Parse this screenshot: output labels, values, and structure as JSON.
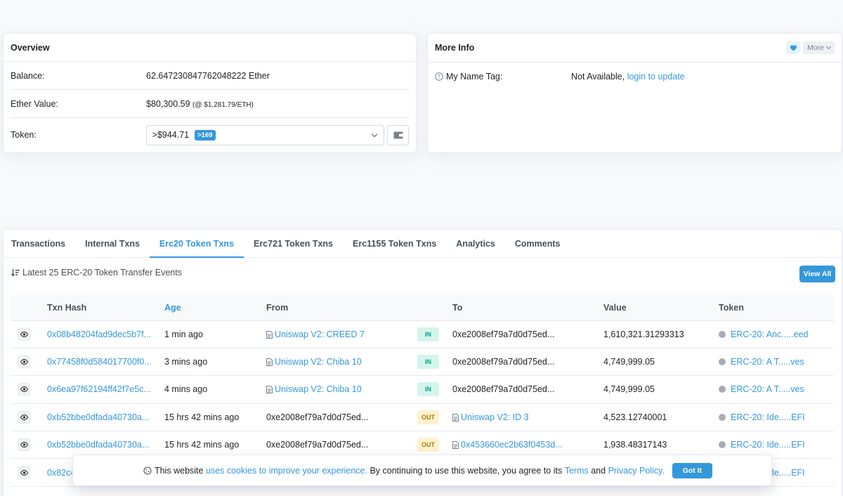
{
  "overview": {
    "title": "Overview",
    "balance_label": "Balance:",
    "balance_value": "62.647230847762048222 Ether",
    "ether_value_label": "Ether Value:",
    "ether_value": "$80,300.59",
    "ether_price_note": "(@ $1,281.79/ETH)",
    "token_label": "Token:",
    "token_value": ">$944.71",
    "token_count_badge": ">169"
  },
  "more_info": {
    "title": "More Info",
    "more_button": "More",
    "name_tag_label": "My Name Tag:",
    "name_tag_value": "Not Available,",
    "name_tag_link": "login to update"
  },
  "tabs": [
    {
      "label": "Transactions",
      "active": false
    },
    {
      "label": "Internal Txns",
      "active": false
    },
    {
      "label": "Erc20 Token Txns",
      "active": true
    },
    {
      "label": "Erc721 Token Txns",
      "active": false
    },
    {
      "label": "Erc1155 Token Txns",
      "active": false
    },
    {
      "label": "Analytics",
      "active": false
    },
    {
      "label": "Comments",
      "active": false
    }
  ],
  "transfers": {
    "summary": "Latest 25 ERC-20 Token Transfer Events",
    "view_all": "View All",
    "columns": [
      "Txn Hash",
      "Age",
      "From",
      "To",
      "Value",
      "Token"
    ],
    "rows": [
      {
        "hash": "0x08b48204fad9dec5b7f...",
        "age": "1 min ago",
        "from": "Uniswap V2: CREED 7",
        "from_link": true,
        "dir": "IN",
        "to": "0xe2008ef79a7d0d75ed...",
        "to_link": false,
        "value": "1,610,321.31293313",
        "token": "ERC-20: Anc.....eed"
      },
      {
        "hash": "0x77458f0d584017700f0...",
        "age": "3 mins ago",
        "from": "Uniswap V2: Chiba 10",
        "from_link": true,
        "dir": "IN",
        "to": "0xe2008ef79a7d0d75ed...",
        "to_link": false,
        "value": "4,749,999.05",
        "token": "ERC-20: A T.....ves"
      },
      {
        "hash": "0x6ea97f62194ff42f7e5c...",
        "age": "4 mins ago",
        "from": "Uniswap V2: Chiba 10",
        "from_link": true,
        "dir": "IN",
        "to": "0xe2008ef79a7d0d75ed...",
        "to_link": false,
        "value": "4,749,999.05",
        "token": "ERC-20: A T.....ves"
      },
      {
        "hash": "0xb52bbe0dfada40730a...",
        "age": "15 hrs 42 mins ago",
        "from": "0xe2008ef79a7d0d75ed...",
        "from_link": false,
        "dir": "OUT",
        "to": "Uniswap V2: ID 3",
        "to_link": true,
        "value": "4,523.12740001",
        "token": "ERC-20: Ide.....EFI"
      },
      {
        "hash": "0xb52bbe0dfada40730a...",
        "age": "15 hrs 42 mins ago",
        "from": "0xe2008ef79a7d0d75ed...",
        "from_link": false,
        "dir": "OUT",
        "to": "0x453660ec2b63f0453d...",
        "to_link": true,
        "value": "1,938.48317143",
        "token": "ERC-20: Ide.....EFI"
      },
      {
        "hash": "0x82c4",
        "age": "",
        "from": "",
        "from_link": false,
        "dir": "",
        "to": "",
        "to_link": false,
        "value": "",
        "token": "ERC-20: Ide.....EFI"
      }
    ]
  },
  "cookie": {
    "text_1": "This website",
    "link_1": "uses cookies to improve your experience.",
    "text_2": "By continuing to use this website, you agree to its",
    "link_terms": "Terms",
    "text_and": "and",
    "link_privacy": "Privacy Policy.",
    "button": "Got It"
  }
}
